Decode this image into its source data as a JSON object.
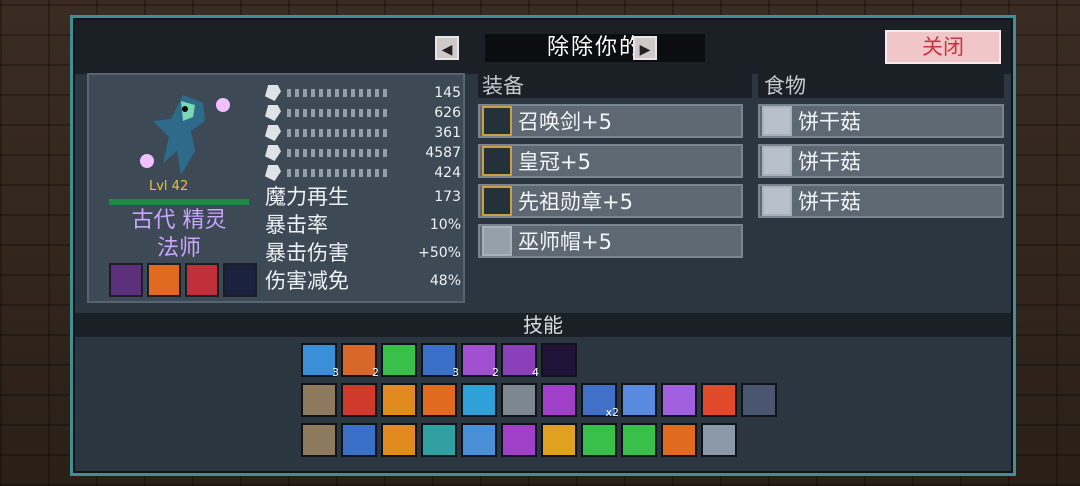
{
  "title": "除除你的",
  "close_label": "关闭",
  "character": {
    "level": "Lvl 42",
    "name_line1": "古代 精灵",
    "name_line2": "法师",
    "stats": [
      {
        "icon": "sword-icon",
        "value": "145"
      },
      {
        "icon": "wand-icon",
        "value": "626"
      },
      {
        "icon": "shield-icon",
        "value": "361"
      },
      {
        "icon": "heart-icon",
        "value": "4587"
      },
      {
        "icon": "mana-icon",
        "value": "424"
      }
    ],
    "secondary": [
      {
        "label": "魔力再生",
        "value": "173"
      },
      {
        "label": "暴击率",
        "value": "10%"
      },
      {
        "label": "暴击伤害",
        "value": "+50%"
      },
      {
        "label": "伤害减免",
        "value": "48%"
      }
    ]
  },
  "equipment": {
    "header": "装备",
    "items": [
      {
        "label": "召唤剑+5",
        "icon": "sword-icon"
      },
      {
        "label": "皇冠+5",
        "icon": "crown-icon"
      },
      {
        "label": "先祖勋章+5",
        "icon": "medal-icon"
      },
      {
        "label": "巫师帽+5",
        "icon": "hat-icon"
      }
    ]
  },
  "food": {
    "header": "食物",
    "items": [
      {
        "label": "饼干菇",
        "icon": "mushroom-icon"
      },
      {
        "label": "饼干菇",
        "icon": "mushroom-icon"
      },
      {
        "label": "饼干菇",
        "icon": "mushroom-icon"
      }
    ]
  },
  "skills": {
    "header": "技能",
    "active": [
      {
        "count": "3",
        "color": "#3a8fd8"
      },
      {
        "count": "2",
        "color": "#d8682a"
      },
      {
        "count": "",
        "color": "#38c04a"
      },
      {
        "count": "3",
        "color": "#3a70c8"
      },
      {
        "count": "2",
        "color": "#a050d0"
      },
      {
        "count": "4",
        "color": "#8a40b8"
      },
      {
        "count": "",
        "color": "#20133a"
      }
    ],
    "row2": [
      "#8d7a5e",
      "#d03a2a",
      "#e08a20",
      "#e06a20",
      "#2fa0d8",
      "#7d8790",
      "#a040c8",
      "#4070c8",
      "#5a8ae0",
      "#a060e0",
      "#e04a2a",
      "#4a5670"
    ],
    "row2_badge": "x2",
    "row3": [
      "#8d7a5e",
      "#3a70c8",
      "#e08a20",
      "#30a0a0",
      "#4a90d8",
      "#a040c8",
      "#e0a020",
      "#38c04a",
      "#38c04a",
      "#e06a20",
      "#8a98a8"
    ]
  },
  "colors": {
    "accent": "#3f8f94",
    "name": "#c9a5ff",
    "level": "#e8c046",
    "close": "#cc3340"
  }
}
